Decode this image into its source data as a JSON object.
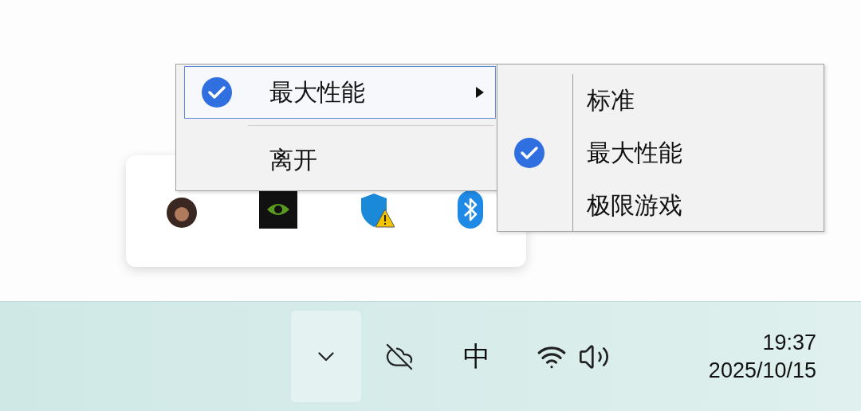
{
  "context_menu": {
    "items": [
      {
        "label": "最大性能",
        "checked": true,
        "submenu": true,
        "selected": true
      },
      {
        "label": "离开",
        "checked": false,
        "submenu": false,
        "selected": false
      }
    ]
  },
  "submenu": {
    "items": [
      {
        "label": "标准",
        "checked": false
      },
      {
        "label": "最大性能",
        "checked": true
      },
      {
        "label": "极限游戏",
        "checked": false
      }
    ]
  },
  "tray_overflow": {
    "icons": [
      {
        "kind": "avatar"
      },
      {
        "kind": "gpu"
      },
      {
        "kind": "shield"
      },
      {
        "kind": "bluetooth"
      }
    ]
  },
  "taskbar": {
    "input_indicator": "中",
    "time": "19:37",
    "date": "2025/10/15"
  }
}
